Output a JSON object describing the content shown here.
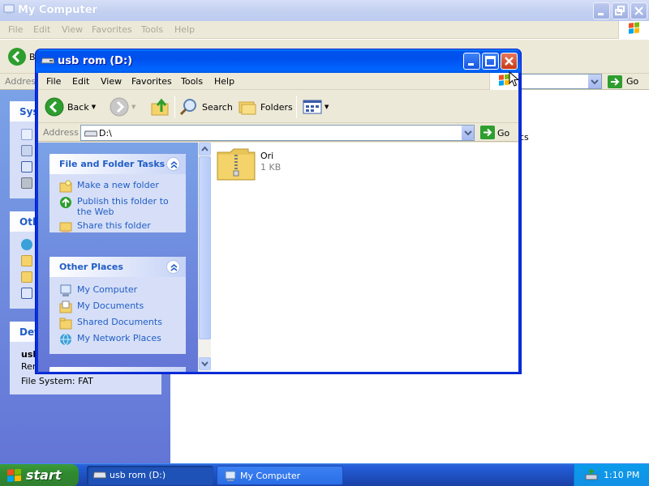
{
  "background_window": {
    "title": "My Computer",
    "menu": [
      "File",
      "Edit",
      "View",
      "Favorites",
      "Tools",
      "Help"
    ],
    "back_label": "B",
    "address_label": "Address",
    "go_label": "Go",
    "panels": {
      "system_tasks_title": "Sys",
      "other_places_title": "Oth",
      "details_title": "Det",
      "details_name": "usb",
      "details_type": "Rem",
      "details_fs": "File System: FAT"
    },
    "partial_text": "cs"
  },
  "window": {
    "title": "usb rom (D:)",
    "menu": [
      "File",
      "Edit",
      "View",
      "Favorites",
      "Tools",
      "Help"
    ],
    "toolbar": {
      "back": "Back",
      "search": "Search",
      "folders": "Folders"
    },
    "address": {
      "label": "Address",
      "value": "D:\\",
      "go": "Go"
    },
    "file_folder_tasks": {
      "title": "File and Folder Tasks",
      "items": [
        "Make a new folder",
        "Publish this folder to the Web",
        "Share this folder"
      ]
    },
    "other_places": {
      "title": "Other Places",
      "items": [
        "My Computer",
        "My Documents",
        "Shared Documents",
        "My Network Places"
      ]
    },
    "files": [
      {
        "name": "Ori",
        "size": "1 KB",
        "icon": "zip-folder-icon"
      }
    ]
  },
  "taskbar": {
    "start_label": "start",
    "tasks": [
      "usb rom (D:)",
      "My Computer"
    ],
    "clock": "1:10 PM"
  },
  "colors": {
    "title_blue": "#0058e6",
    "task_pane_text": "#215dc6",
    "start_green": "#3c9a3c"
  }
}
